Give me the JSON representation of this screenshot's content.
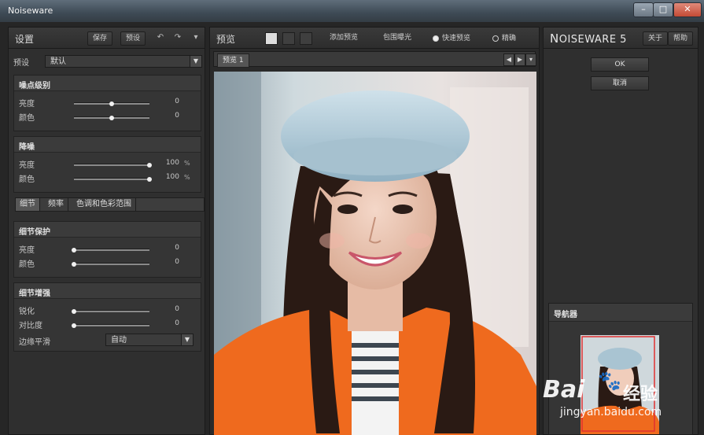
{
  "window": {
    "title": "Noiseware",
    "min": "–",
    "max": "□",
    "close": "✕"
  },
  "left": {
    "title": "设置",
    "save_label": "保存",
    "preset_label": "预设",
    "preset_row_label": "预设",
    "preset_value": "默认",
    "noise_level": {
      "title": "噪点级别",
      "rows": [
        {
          "label": "亮度",
          "value": "0",
          "level": 0.5
        },
        {
          "label": "颜色",
          "value": "0",
          "level": 0.5
        }
      ]
    },
    "denoise": {
      "title": "降噪",
      "rows": [
        {
          "label": "亮度",
          "value": "100",
          "unit": "%",
          "level": 1.0
        },
        {
          "label": "颜色",
          "value": "100",
          "unit": "%",
          "level": 1.0
        }
      ]
    },
    "tabs": [
      "细节",
      "频率",
      "色调和色彩范围"
    ],
    "detail_protect": {
      "title": "细节保护",
      "rows": [
        {
          "label": "亮度",
          "value": "0",
          "level": 0.0
        },
        {
          "label": "颜色",
          "value": "0",
          "level": 0.0
        }
      ]
    },
    "detail_enhance": {
      "title": "细节增强",
      "rows": [
        {
          "label": "锐化",
          "value": "0",
          "level": 0.0
        },
        {
          "label": "对比度",
          "value": "0",
          "level": 0.0
        }
      ],
      "edge_label": "边缘平滑",
      "edge_value": "自动"
    }
  },
  "center": {
    "title": "预览",
    "add_preview": "添加预览",
    "clip_exposure": "包围曝光",
    "fast_preview": "快速预览",
    "precise": "精确",
    "doc_tab": "预览 1"
  },
  "right": {
    "brand_n": "N",
    "brand_rest": "OISEWARE 5",
    "about": "关于",
    "help": "帮助",
    "ok": "OK",
    "cancel": "取消",
    "navigator_title": "导航器"
  },
  "watermark": {
    "brand": "Bai",
    "brand2": "经验",
    "url": "jingyan.baidu.com"
  }
}
